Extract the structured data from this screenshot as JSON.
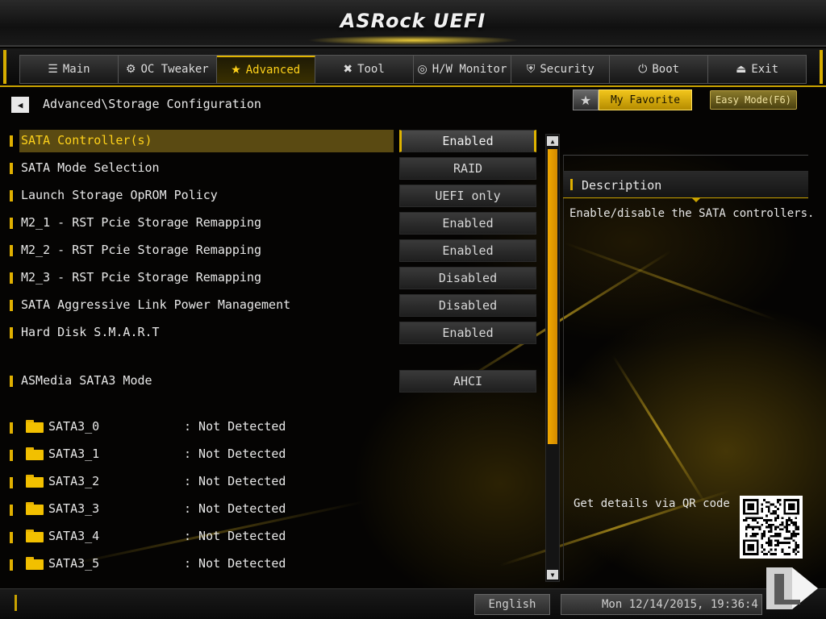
{
  "header": {
    "logo": "ASRock UEFI"
  },
  "tabs": [
    {
      "label": "Main",
      "icon": "list-icon",
      "glyph": "☰",
      "active": false
    },
    {
      "label": "OC Tweaker",
      "icon": "rocket-icon",
      "glyph": "⚙",
      "active": false
    },
    {
      "label": "Advanced",
      "icon": "star-icon",
      "glyph": "★",
      "active": true
    },
    {
      "label": "Tool",
      "icon": "tools-icon",
      "glyph": "✖",
      "active": false
    },
    {
      "label": "H/W Monitor",
      "icon": "monitor-icon",
      "glyph": "◎",
      "active": false
    },
    {
      "label": "Security",
      "icon": "shield-icon",
      "glyph": "⛨",
      "active": false
    },
    {
      "label": "Boot",
      "icon": "power-icon",
      "glyph": "⏻",
      "active": false
    },
    {
      "label": "Exit",
      "icon": "exit-icon",
      "glyph": "⏏",
      "active": false
    }
  ],
  "breadcrumb": "Advanced\\Storage Configuration",
  "buttons": {
    "favorite": "My Favorite",
    "easy_mode": "Easy Mode(F6)"
  },
  "settings": [
    {
      "label": "SATA Controller(s)",
      "value": "Enabled",
      "selected": true
    },
    {
      "label": "SATA Mode Selection",
      "value": "RAID"
    },
    {
      "label": "Launch Storage OpROM Policy",
      "value": "UEFI only"
    },
    {
      "label": "M2_1 - RST Pcie Storage Remapping",
      "value": "Enabled"
    },
    {
      "label": "M2_2 - RST Pcie Storage Remapping",
      "value": "Enabled"
    },
    {
      "label": "M2_3 - RST Pcie Storage Remapping",
      "value": "Disabled"
    },
    {
      "label": "SATA Aggressive Link Power Management",
      "value": "Disabled"
    },
    {
      "label": "Hard Disk S.M.A.R.T",
      "value": "Enabled"
    },
    {
      "label": "ASMedia SATA3 Mode",
      "value": "AHCI"
    }
  ],
  "drives": [
    {
      "name": "SATA3_0",
      "status": ": Not Detected"
    },
    {
      "name": "SATA3_1",
      "status": ": Not Detected"
    },
    {
      "name": "SATA3_2",
      "status": ": Not Detected"
    },
    {
      "name": "SATA3_3",
      "status": ": Not Detected"
    },
    {
      "name": "SATA3_4",
      "status": ": Not Detected"
    },
    {
      "name": "SATA3_5",
      "status": ": Not Detected"
    }
  ],
  "description": {
    "title": "Description",
    "text": "Enable/disable the SATA controllers.",
    "qr_label": "Get details via QR code"
  },
  "footer": {
    "language": "English",
    "datetime": "Mon 12/14/2015, 19:36:4"
  },
  "colors": {
    "accent": "#e0b400",
    "selected_row": "#5a4a12",
    "scrollbar": "#f0a800"
  }
}
